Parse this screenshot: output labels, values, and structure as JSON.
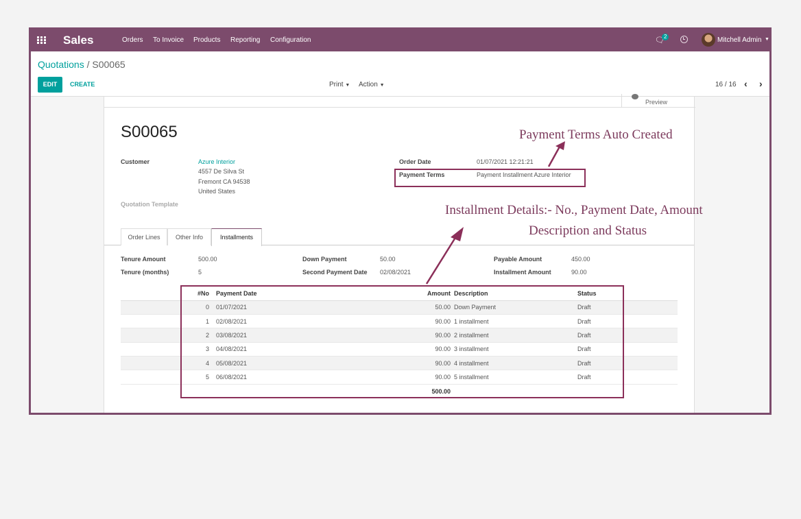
{
  "navbar": {
    "app_name": "Sales",
    "menu": [
      "Orders",
      "To Invoice",
      "Products",
      "Reporting",
      "Configuration"
    ],
    "chat_count": "2",
    "user_name": "Mitchell Admin"
  },
  "control": {
    "breadcrumb_parent": "Quotations",
    "breadcrumb_sep": "/",
    "breadcrumb_current": "S00065",
    "edit_label": "EDIT",
    "create_label": "CREATE",
    "print_label": "Print",
    "action_label": "Action",
    "pager": "16 / 16"
  },
  "form": {
    "preview_label": "Preview",
    "name": "S00065",
    "customer_label": "Customer",
    "customer_name": "Azure Interior",
    "address": [
      "4557 De Silva St",
      "Fremont CA 94538",
      "United States"
    ],
    "quotation_template_label": "Quotation Template",
    "order_date_label": "Order Date",
    "order_date": "01/07/2021 12:21:21",
    "payment_terms_label": "Payment Terms",
    "payment_terms": "Payment Installment Azure Interior",
    "tabs": [
      "Order Lines",
      "Other Info",
      "Installments"
    ],
    "tenure_amount_label": "Tenure Amount",
    "tenure_amount": "500.00",
    "tenure_months_label": "Tenure (months)",
    "tenure_months": "5",
    "down_payment_label": "Down Payment",
    "down_payment": "50.00",
    "second_payment_date_label": "Second Payment Date",
    "second_payment_date": "02/08/2021",
    "payable_amount_label": "Payable Amount",
    "payable_amount": "450.00",
    "installment_amount_label": "Installment Amount",
    "installment_amount": "90.00"
  },
  "installments": {
    "headers": [
      "#No",
      "Payment Date",
      "Amount",
      "Description",
      "Status"
    ],
    "rows": [
      [
        "0",
        "01/07/2021",
        "50.00",
        "Down Payment",
        "Draft"
      ],
      [
        "1",
        "02/08/2021",
        "90.00",
        "1 installment",
        "Draft"
      ],
      [
        "2",
        "03/08/2021",
        "90.00",
        "2 installment",
        "Draft"
      ],
      [
        "3",
        "04/08/2021",
        "90.00",
        "3 installment",
        "Draft"
      ],
      [
        "4",
        "05/08/2021",
        "90.00",
        "4 installment",
        "Draft"
      ],
      [
        "5",
        "06/08/2021",
        "90.00",
        "5 installment",
        "Draft"
      ]
    ],
    "total": "500.00"
  },
  "annotations": {
    "payment_terms_note": "Payment Terms Auto Created",
    "installment_note_line1": "Installment Details:- No., Payment Date, Amount",
    "installment_note_line2": "Description and Status"
  },
  "colors": {
    "brand": "#7c4b6c",
    "accent": "#00a09d",
    "annotation": "#8b2f59"
  }
}
